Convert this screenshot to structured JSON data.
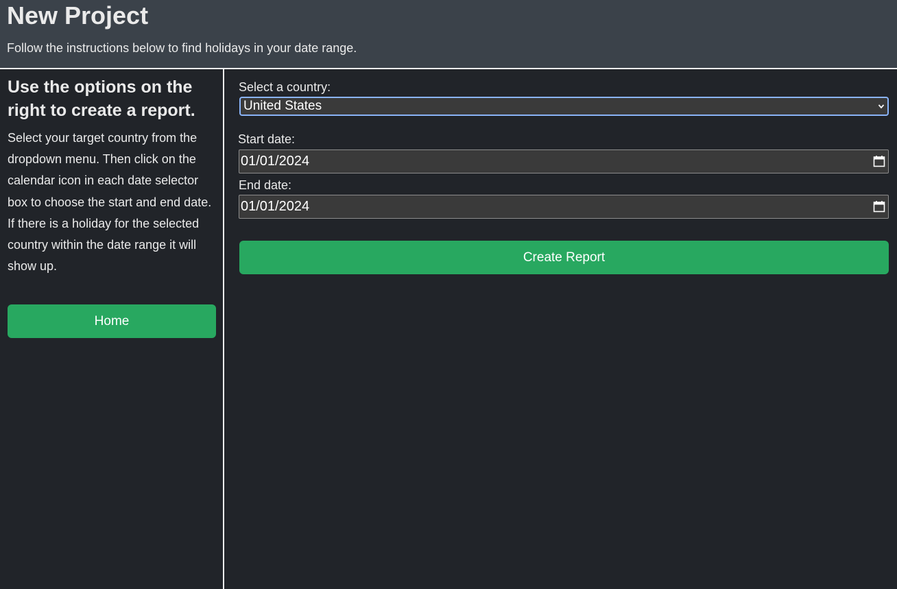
{
  "header": {
    "title": "New Project",
    "subtitle": "Follow the instructions below to find holidays in your date range."
  },
  "sidebar": {
    "heading": "Use the options on the right to create a report.",
    "instructions": "Select your target country from the dropdown menu. Then click on the calendar icon in each date selector box to choose the start and end date. If there is a holiday for the selected country within the date range it will show up.",
    "home_label": "Home"
  },
  "form": {
    "country_label": "Select a country:",
    "country_value": "United States",
    "start_label": "Start date:",
    "start_value": "01/01/2024",
    "end_label": "End date:",
    "end_value": "01/01/2024",
    "submit_label": "Create Report"
  },
  "icons": {
    "dropdown": "chevron-down-icon",
    "date_picker": "calendar-icon"
  },
  "colors": {
    "accent": "#28a860",
    "header_bg": "#3b424a",
    "page_bg": "#212429",
    "focus_border": "#8ab4f8"
  }
}
